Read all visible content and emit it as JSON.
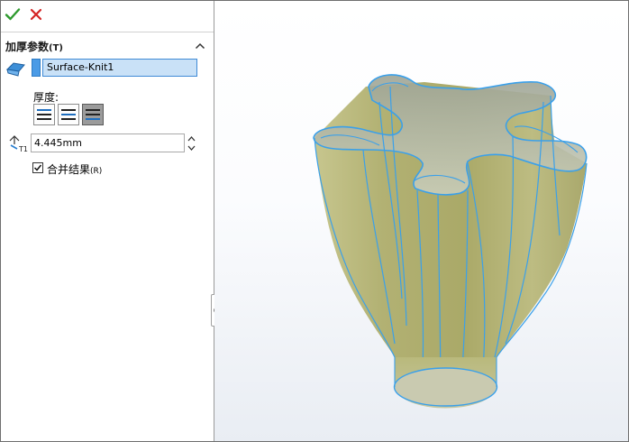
{
  "toolbar": {
    "ok_icon": "check-icon",
    "cancel_icon": "x-icon",
    "ok_color": "#2e9a2e",
    "cancel_color": "#d42424"
  },
  "section": {
    "title": "加厚参数",
    "title_hotkey": "(T)",
    "collapse_icon": "chevron-up-icon"
  },
  "selection": {
    "icon": "surface-face-icon",
    "swatch_color": "#4b9be6",
    "value": "Surface-Knit1"
  },
  "thickness": {
    "label": "厚度:",
    "options": [
      "thicken-side-1",
      "thicken-both-sides",
      "thicken-side-2"
    ],
    "selected": "thicken-side-2"
  },
  "dimension": {
    "icon": "thickness-dimension-icon",
    "value": "4.445mm"
  },
  "merge": {
    "label": "合并结果",
    "hotkey": "(R)",
    "checked": true
  },
  "model": {
    "surface_color": "#b6b57a",
    "edge_color": "#3aa0ea"
  }
}
